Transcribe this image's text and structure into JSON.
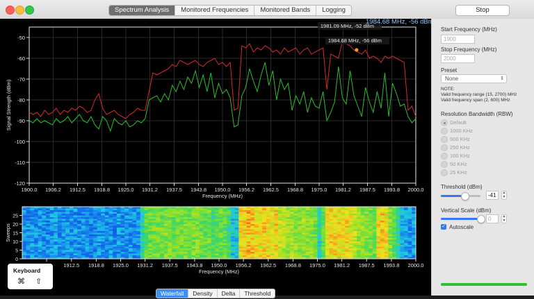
{
  "window": {
    "tabs": [
      "Spectrum Analysis",
      "Monitored Frequencies",
      "Monitored Bands",
      "Logging"
    ],
    "active_tab": 0,
    "stop_label": "Stop"
  },
  "readout": "1984.68 MHz, -56 dBm",
  "chart_data": [
    {
      "type": "line",
      "ylabel": "Signal Strength (dBm)",
      "xlabel": "Frequency (MHz)",
      "xlim": [
        1900,
        2000
      ],
      "ylim": [
        -120,
        -45
      ],
      "xticks": [
        "1900.0",
        "1906.2",
        "1912.5",
        "1918.8",
        "1925.0",
        "1931.2",
        "1937.5",
        "1943.8",
        "1950.0",
        "1956.2",
        "1962.5",
        "1968.8",
        "1975.0",
        "1981.2",
        "1987.5",
        "1993.8",
        "2000.0"
      ],
      "yticks": [
        -50,
        -60,
        -70,
        -80,
        -90,
        -100,
        -110,
        -120
      ],
      "series": [
        {
          "color": "#d42a2a",
          "x": [
            1900,
            1901,
            1902,
            1903,
            1904,
            1905,
            1906,
            1907,
            1908,
            1909,
            1910,
            1911,
            1912,
            1913,
            1914,
            1915,
            1916,
            1917,
            1918,
            1919,
            1920,
            1921,
            1922,
            1923,
            1924,
            1925,
            1926,
            1927,
            1928,
            1929,
            1930,
            1931,
            1932,
            1933,
            1934,
            1935,
            1936,
            1937,
            1938,
            1939,
            1940,
            1941,
            1942,
            1943,
            1944,
            1945,
            1946,
            1947,
            1948,
            1949,
            1950,
            1951,
            1952,
            1953,
            1954,
            1955,
            1956,
            1957,
            1958,
            1959,
            1960,
            1961,
            1962,
            1963,
            1964,
            1965,
            1966,
            1967,
            1968,
            1969,
            1970,
            1971,
            1972,
            1973,
            1974,
            1975,
            1976,
            1977,
            1978,
            1979,
            1980,
            1981,
            1982,
            1983,
            1984,
            1985,
            1986,
            1987,
            1988,
            1989,
            1990,
            1991,
            1992,
            1993,
            1994,
            1995,
            1996,
            1997,
            1998,
            1999,
            2000
          ],
          "y": [
            -86,
            -87,
            -86,
            -88,
            -85,
            -87,
            -86,
            -84,
            -87,
            -85,
            -86,
            -84,
            -85,
            -83,
            -84,
            -86,
            -85,
            -80,
            -77,
            -84,
            -87,
            -86,
            -85,
            -87,
            -88,
            -89,
            -87,
            -86,
            -84,
            -85,
            -85,
            -76,
            -67,
            -68,
            -67,
            -66,
            -65,
            -63,
            -64,
            -61,
            -62,
            -63,
            -62,
            -61,
            -63,
            -64,
            -62,
            -61,
            -60,
            -63,
            -62,
            -64,
            -62,
            -85,
            -84,
            -54,
            -55,
            -53,
            -57,
            -55,
            -56,
            -54,
            -55,
            -57,
            -56,
            -58,
            -55,
            -57,
            -56,
            -55,
            -58,
            -56,
            -55,
            -58,
            -57,
            -56,
            -55,
            -75,
            -58,
            -59,
            -60,
            -52,
            -53,
            -54,
            -56,
            -57,
            -58,
            -56,
            -60,
            -59,
            -60,
            -62,
            -59,
            -60,
            -59,
            -60,
            -61,
            -62,
            -85,
            -83,
            -88
          ]
        },
        {
          "color": "#2bbf2b",
          "x": [
            1900,
            1901,
            1902,
            1903,
            1904,
            1905,
            1906,
            1907,
            1908,
            1909,
            1910,
            1911,
            1912,
            1913,
            1914,
            1915,
            1916,
            1917,
            1918,
            1919,
            1920,
            1921,
            1922,
            1923,
            1924,
            1925,
            1926,
            1927,
            1928,
            1929,
            1930,
            1931,
            1932,
            1933,
            1934,
            1935,
            1936,
            1937,
            1938,
            1939,
            1940,
            1941,
            1942,
            1943,
            1944,
            1945,
            1946,
            1947,
            1948,
            1949,
            1950,
            1951,
            1952,
            1953,
            1954,
            1955,
            1956,
            1957,
            1958,
            1959,
            1960,
            1961,
            1962,
            1963,
            1964,
            1965,
            1966,
            1967,
            1968,
            1969,
            1970,
            1971,
            1972,
            1973,
            1974,
            1975,
            1976,
            1977,
            1978,
            1979,
            1980,
            1981,
            1982,
            1983,
            1984,
            1985,
            1986,
            1987,
            1988,
            1989,
            1990,
            1991,
            1992,
            1993,
            1994,
            1995,
            1996,
            1997,
            1998,
            1999,
            2000
          ],
          "y": [
            -90,
            -91,
            -89,
            -91,
            -90,
            -91,
            -92,
            -89,
            -91,
            -90,
            -88,
            -91,
            -89,
            -87,
            -90,
            -91,
            -88,
            -92,
            -94,
            -88,
            -90,
            -95,
            -89,
            -91,
            -92,
            -90,
            -93,
            -92,
            -90,
            -91,
            -89,
            -80,
            -79,
            -78,
            -81,
            -77,
            -80,
            -73,
            -76,
            -71,
            -75,
            -69,
            -72,
            -66,
            -74,
            -68,
            -76,
            -67,
            -79,
            -72,
            -77,
            -75,
            -79,
            -93,
            -92,
            -78,
            -74,
            -65,
            -71,
            -76,
            -68,
            -62,
            -73,
            -66,
            -80,
            -70,
            -75,
            -72,
            -85,
            -78,
            -82,
            -76,
            -86,
            -79,
            -83,
            -84,
            -76,
            -90,
            -86,
            -81,
            -64,
            -79,
            -82,
            -66,
            -78,
            -83,
            -88,
            -74,
            -81,
            -86,
            -76,
            -84,
            -67,
            -88,
            -72,
            -77,
            -83,
            -82,
            -88,
            -91,
            -89
          ]
        }
      ],
      "markers": [
        {
          "label": "1981.09 MHz, -52 dBm",
          "x": 1981.09,
          "y": -52
        },
        {
          "label": "1984.68 MHz, -56 dBm",
          "x": 1984.68,
          "y": -56
        }
      ]
    },
    {
      "type": "heatmap",
      "ylabel": "Sweeps",
      "xlabel": "Frequency (MHz)",
      "xlim": [
        1900,
        2000
      ],
      "ylim": [
        0,
        30
      ],
      "yticks": [
        0,
        5,
        10,
        15,
        20,
        25
      ],
      "xticks": [
        ".2",
        "1912.5",
        "1918.8",
        "1925.0",
        "1931.2",
        "1937.5",
        "1943.8",
        "1950.0",
        "1956.2",
        "1962.5",
        "1968.8",
        "1975.0",
        "1981.2",
        "1987.5",
        "1993.8",
        "2000.0"
      ],
      "band_levels": [
        0.25,
        0.25,
        0.28,
        0.25,
        0.27,
        0.26,
        0.24,
        0.27,
        0.29,
        0.26,
        0.25,
        0.28,
        0.27,
        0.26,
        0.25,
        0.27,
        0.26,
        0.24,
        0.25,
        0.27,
        0.26,
        0.25,
        0.27,
        0.24,
        0.26,
        0.25,
        0.27,
        0.25,
        0.26,
        0.27,
        0.42,
        0.55,
        0.58,
        0.6,
        0.6,
        0.58,
        0.62,
        0.6,
        0.57,
        0.61,
        0.59,
        0.6,
        0.58,
        0.6,
        0.62,
        0.58,
        0.56,
        0.6,
        0.5,
        0.55,
        0.57,
        0.55,
        0.5,
        0.35,
        0.36,
        0.8,
        0.82,
        0.85,
        0.84,
        0.8,
        0.78,
        0.83,
        0.8,
        0.75,
        0.82,
        0.72,
        0.7,
        0.66,
        0.68,
        0.64,
        0.62,
        0.65,
        0.63,
        0.64,
        0.6,
        0.4,
        0.55,
        0.78,
        0.8,
        0.82,
        0.8,
        0.78,
        0.8,
        0.76,
        0.72,
        0.65,
        0.63,
        0.62,
        0.6,
        0.58,
        0.8,
        0.83,
        0.78,
        0.62,
        0.55,
        0.45,
        0.3,
        0.3,
        0.28,
        0.27
      ]
    }
  ],
  "view_tabs": [
    "Waterfall",
    "Density",
    "Delta",
    "Threshold"
  ],
  "active_view_tab": 0,
  "sidebar": {
    "start_label": "Start Frequency (MHz)",
    "start_placeholder": "1900",
    "stop_label": "Stop Frequency (MHz)",
    "stop_placeholder": "2000",
    "preset_label": "Preset",
    "preset_value": "None",
    "note_title": "NOTE:",
    "note_line1": "Valid frequency range (15, 2700) MHz",
    "note_line2": "Valid frequency span (2, 600) MHz",
    "rbw_label": "Resolution Bandwidth (RBW)",
    "rbw_options": [
      "Default",
      "1000 KHz",
      "500 KHz",
      "250 KHz",
      "100 KHz",
      "50 KHz",
      "25 KHz"
    ],
    "threshold_label": "Threshold (dBm)",
    "threshold_value": "-41",
    "threshold_level": 0.6,
    "vscale_label": "Vertical Scale (dBm)",
    "vscale_value": "0",
    "vscale_level": 1.0,
    "autoscale_label": "Autoscale",
    "autoscale_checked": true,
    "progress": 1.0
  },
  "keyboard": {
    "title": "Keyboard",
    "cmd_glyph": "⌘",
    "shift_glyph": "⇧"
  }
}
